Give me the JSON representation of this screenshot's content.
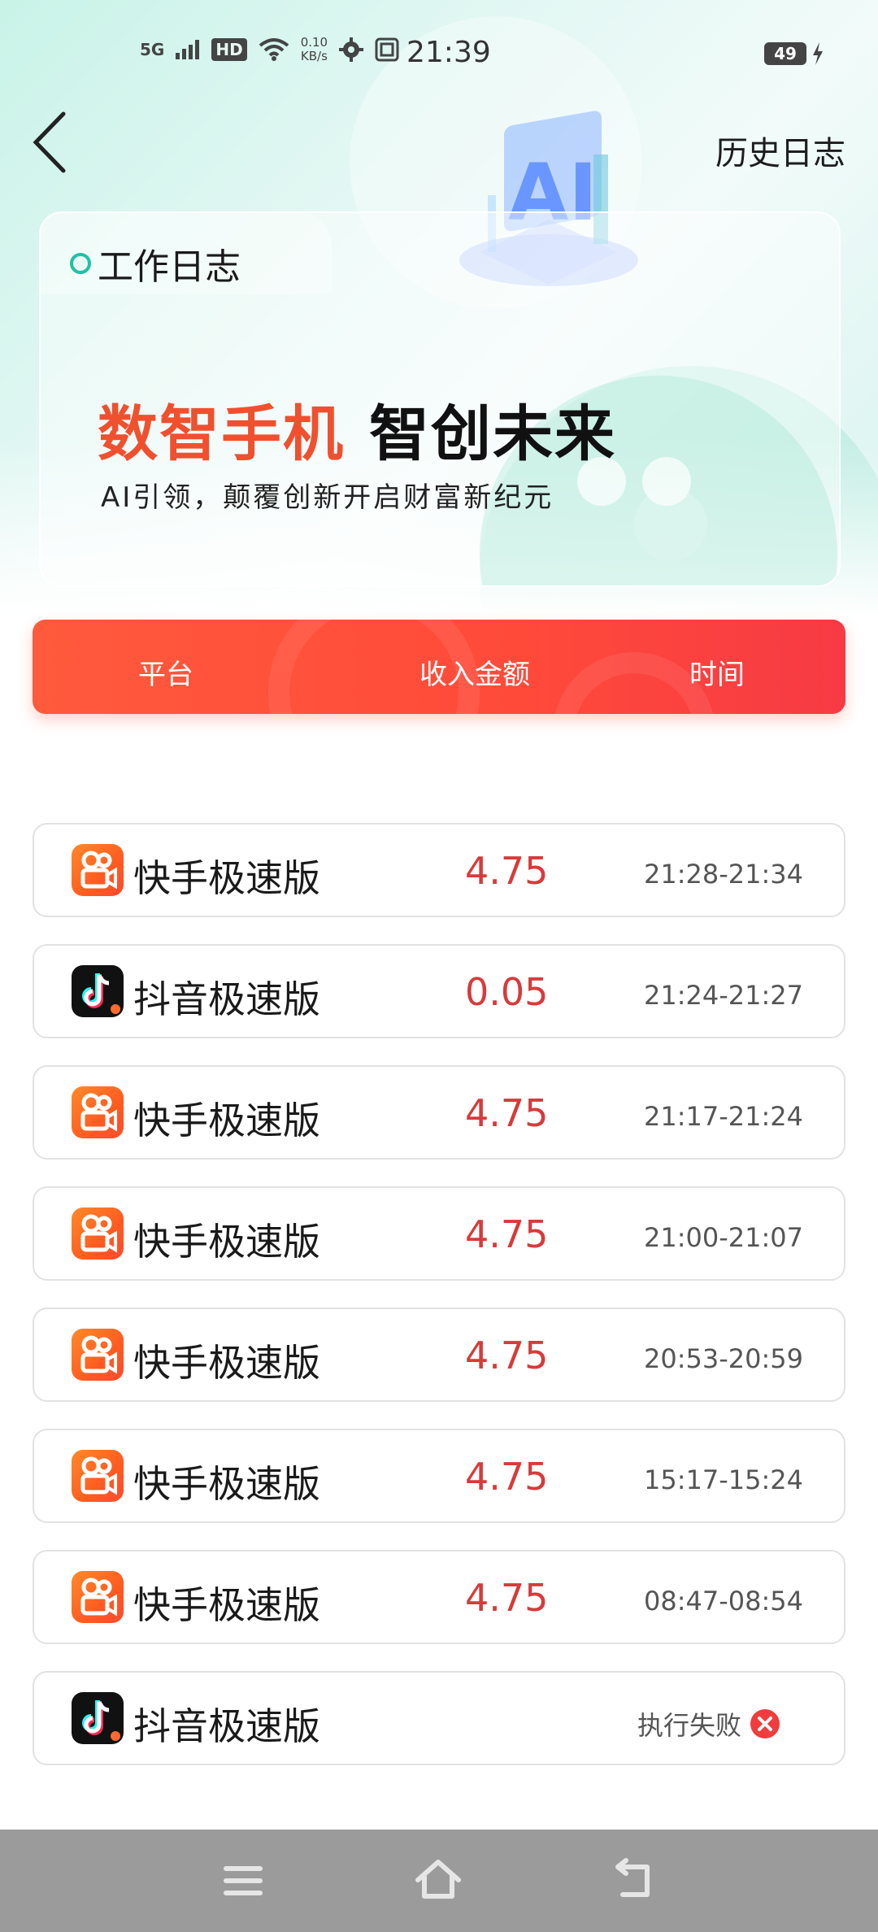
{
  "status_bar": {
    "network": "5G",
    "hd": "HD",
    "speed_value": "0.10",
    "speed_unit": "KB/s",
    "time": "21:39",
    "battery": "49"
  },
  "header": {
    "history_label": "历史日志"
  },
  "card": {
    "tab_title": "工作日志",
    "slogan_red": "数智手机",
    "slogan_black": "智创未来",
    "subtitle": "AI引领，颠覆创新开启财富新纪元"
  },
  "table_header": {
    "platform": "平台",
    "amount": "收入金额",
    "time": "时间"
  },
  "rows": [
    {
      "app": "快手极速版",
      "icon": "kuaishou-icon",
      "amount": "4.75",
      "time": "21:28-21:34"
    },
    {
      "app": "抖音极速版",
      "icon": "douyin-icon",
      "amount": "0.05",
      "time": "21:24-21:27"
    },
    {
      "app": "快手极速版",
      "icon": "kuaishou-icon",
      "amount": "4.75",
      "time": "21:17-21:24"
    },
    {
      "app": "快手极速版",
      "icon": "kuaishou-icon",
      "amount": "4.75",
      "time": "21:00-21:07"
    },
    {
      "app": "快手极速版",
      "icon": "kuaishou-icon",
      "amount": "4.75",
      "time": "20:53-20:59"
    },
    {
      "app": "快手极速版",
      "icon": "kuaishou-icon",
      "amount": "4.75",
      "time": "15:17-15:24"
    },
    {
      "app": "快手极速版",
      "icon": "kuaishou-icon",
      "amount": "4.75",
      "time": "08:47-08:54"
    },
    {
      "app": "抖音极速版",
      "icon": "douyin-icon",
      "status": "执行失败"
    }
  ],
  "colors": {
    "accent_red": "#ff4a3a",
    "amount_red": "#d83a3a",
    "teal": "#1dc3a4"
  }
}
